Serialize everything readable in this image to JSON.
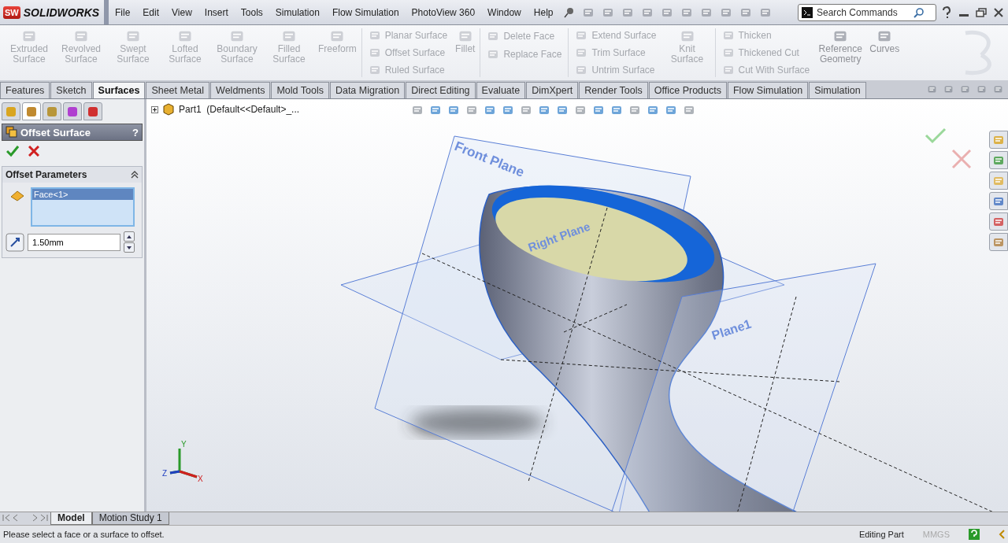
{
  "title_bar": {
    "logo_badge": "SW",
    "logo_text": "SOLIDWORKS",
    "menu": [
      "File",
      "Edit",
      "View",
      "Insert",
      "Tools",
      "Simulation",
      "Flow Simulation",
      "PhotoView 360",
      "Window",
      "Help"
    ],
    "search": {
      "placeholder": "Search Commands"
    }
  },
  "ribbon": {
    "groups": [
      {
        "kind": "large",
        "items": [
          {
            "label": "Extruded Surface",
            "disabled": true
          },
          {
            "label": "Revolved Surface",
            "disabled": true
          },
          {
            "label": "Swept Surface",
            "disabled": true
          },
          {
            "label": "Lofted Surface",
            "disabled": true
          },
          {
            "label": "Boundary Surface",
            "disabled": true
          },
          {
            "label": "Filled Surface",
            "disabled": true
          },
          {
            "label": "Freeform",
            "disabled": true
          }
        ]
      },
      {
        "kind": "stack",
        "items": [
          {
            "label": "Planar Surface",
            "disabled": true
          },
          {
            "label": "Offset Surface",
            "disabled": true
          },
          {
            "label": "Ruled Surface",
            "disabled": true
          }
        ]
      },
      {
        "kind": "large",
        "items": [
          {
            "label": "Fillet",
            "disabled": true
          }
        ]
      },
      {
        "kind": "stack",
        "items": [
          {
            "label": "Delete Face",
            "disabled": true
          },
          {
            "label": "Replace Face",
            "disabled": true
          }
        ]
      },
      {
        "kind": "stack",
        "items": [
          {
            "label": "Extend Surface",
            "disabled": true
          },
          {
            "label": "Trim Surface",
            "disabled": true
          },
          {
            "label": "Untrim Surface",
            "disabled": true
          }
        ]
      },
      {
        "kind": "large",
        "items": [
          {
            "label": "Knit Surface",
            "disabled": true
          }
        ]
      },
      {
        "kind": "stack",
        "items": [
          {
            "label": "Thicken",
            "disabled": true
          },
          {
            "label": "Thickened Cut",
            "disabled": true
          },
          {
            "label": "Cut With Surface",
            "disabled": true
          }
        ]
      },
      {
        "kind": "large",
        "items": [
          {
            "label": "Reference Geometry",
            "disabled": false
          },
          {
            "label": "Curves",
            "disabled": false
          }
        ]
      }
    ]
  },
  "tabs": [
    {
      "label": "Features",
      "selected": false
    },
    {
      "label": "Sketch",
      "selected": false
    },
    {
      "label": "Surfaces",
      "selected": true
    },
    {
      "label": "Sheet Metal",
      "selected": false
    },
    {
      "label": "Weldments",
      "selected": false
    },
    {
      "label": "Mold Tools",
      "selected": false
    },
    {
      "label": "Data Migration",
      "selected": false
    },
    {
      "label": "Direct Editing",
      "selected": false
    },
    {
      "label": "Evaluate",
      "selected": false
    },
    {
      "label": "DimXpert",
      "selected": false
    },
    {
      "label": "Render Tools",
      "selected": false
    },
    {
      "label": "Office Products",
      "selected": false
    },
    {
      "label": "Flow Simulation",
      "selected": false
    },
    {
      "label": "Simulation",
      "selected": false
    }
  ],
  "panel": {
    "icon_tabs": [
      {
        "selected": false
      },
      {
        "selected": true
      },
      {
        "selected": false
      },
      {
        "selected": false
      },
      {
        "selected": false
      }
    ],
    "title": "Offset Surface",
    "help": "?",
    "section": "Offset Parameters",
    "faces": [
      {
        "label": "Face<1>",
        "selected": true
      }
    ],
    "distance": "1.50mm"
  },
  "tree": {
    "part": "Part1",
    "config": "(Default<<Default>_..."
  },
  "viewport": {
    "planes": [
      "Front Plane",
      "Right Plane",
      "Plane1"
    ],
    "triad": [
      "Y",
      "Z",
      "X"
    ]
  },
  "bottom_tabs": [
    {
      "label": "Model",
      "selected": true
    },
    {
      "label": "Motion Study 1",
      "selected": false
    }
  ],
  "status_bar": {
    "message": "Please select a face or a surface to offset.",
    "mode": "Editing Part",
    "units": {
      "text": "MMGS",
      "disabled": true
    }
  }
}
